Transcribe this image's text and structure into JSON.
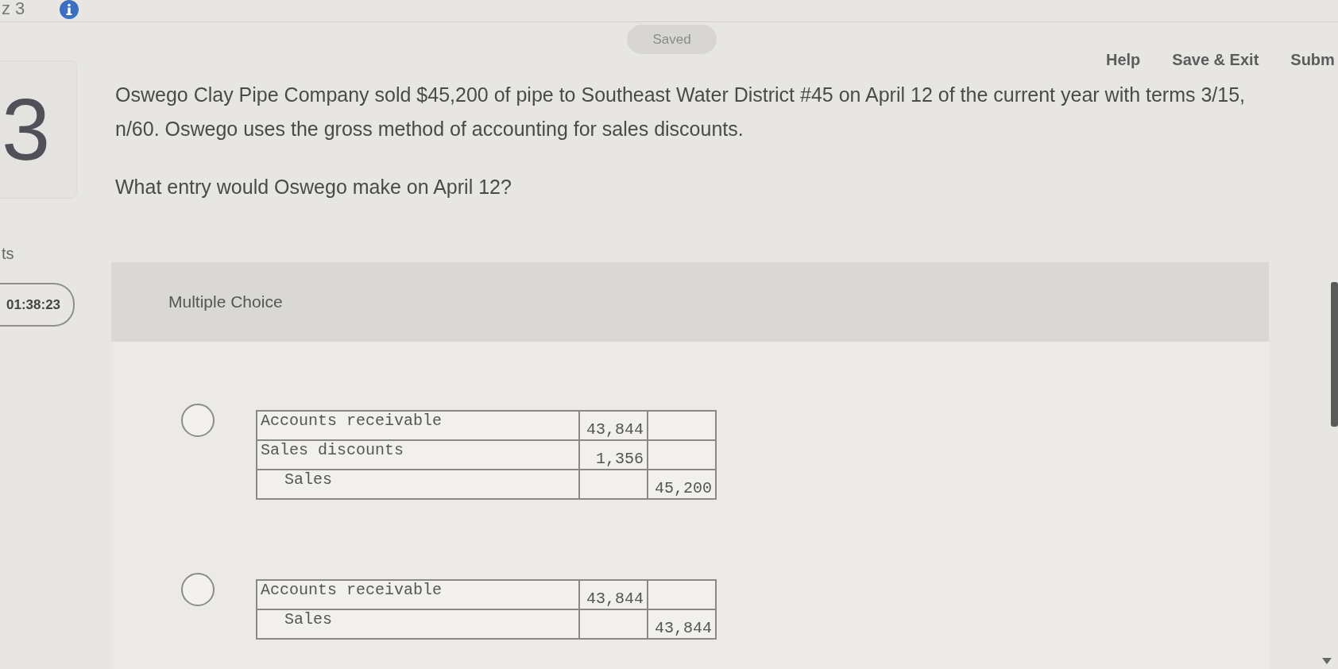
{
  "top_bar": {
    "quiz_title": "z 3"
  },
  "toolbar": {
    "saved_status": "Saved",
    "links": [
      "Help",
      "Save & Exit",
      "Subm"
    ]
  },
  "question": {
    "number": "3",
    "points_label": "ts",
    "timer": "01:38:23",
    "text": "Oswego Clay Pipe Company sold $45,200 of pipe to Southeast Water District #45 on April 12 of the current year with terms 3/15, n/60. Oswego uses the gross method of accounting for sales discounts.",
    "prompt": "What entry would Oswego make on April 12?"
  },
  "answer": {
    "type_label": "Multiple Choice",
    "options": [
      {
        "selected": false,
        "rows": [
          {
            "kind": "debit",
            "account": "Accounts receivable",
            "amount": "43,844"
          },
          {
            "kind": "debit",
            "account": "Sales discounts",
            "amount": "1,356"
          },
          {
            "kind": "credit",
            "account": "Sales",
            "amount": "45,200"
          }
        ]
      },
      {
        "selected": false,
        "rows": [
          {
            "kind": "debit",
            "account": "Accounts receivable",
            "amount": "43,844"
          },
          {
            "kind": "credit",
            "account": "Sales",
            "amount": "43,844"
          }
        ]
      }
    ]
  }
}
